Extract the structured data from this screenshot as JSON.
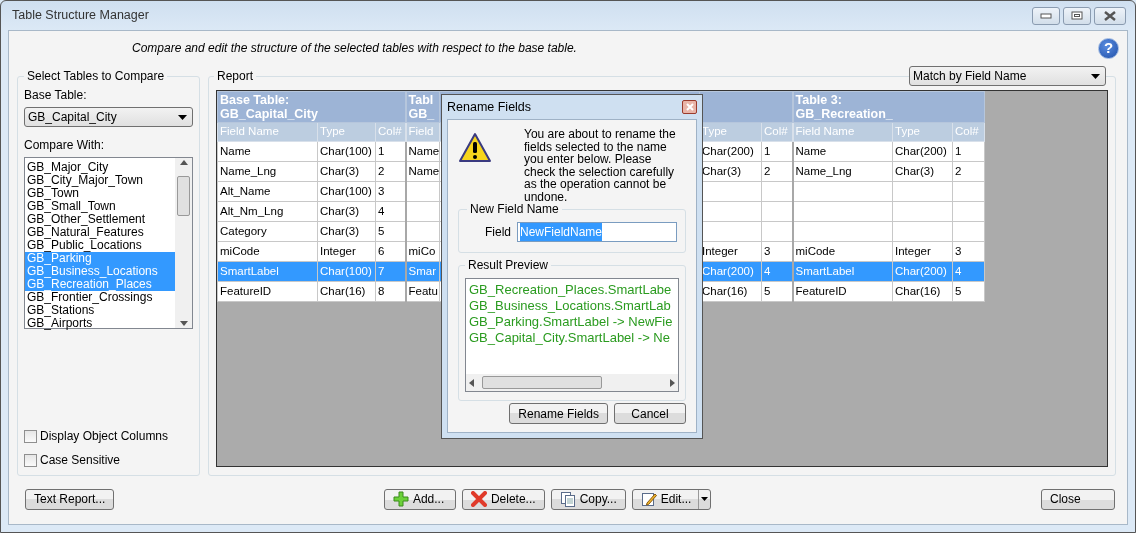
{
  "window": {
    "title": "Table Structure Manager"
  },
  "help_button": "?",
  "description": "Compare and edit the structure of the selected tables with respect to the base table.",
  "select_panel": {
    "title": "Select Tables to Compare",
    "base_label": "Base Table:",
    "base_value": "GB_Capital_City",
    "compare_label": "Compare With:",
    "compare_items": [
      {
        "label": "GB_Major_City",
        "selected": false
      },
      {
        "label": "GB_City_Major_Town",
        "selected": false
      },
      {
        "label": "GB_Town",
        "selected": false
      },
      {
        "label": "GB_Small_Town",
        "selected": false
      },
      {
        "label": "GB_Other_Settlement",
        "selected": false
      },
      {
        "label": "GB_Natural_Features",
        "selected": false
      },
      {
        "label": "GB_Public_Locations",
        "selected": false
      },
      {
        "label": "GB_Parking",
        "selected": true
      },
      {
        "label": "GB_Business_Locations",
        "selected": true
      },
      {
        "label": "GB_Recreation_Places",
        "selected": true
      },
      {
        "label": "GB_Frontier_Crossings",
        "selected": false
      },
      {
        "label": "GB_Stations",
        "selected": false
      },
      {
        "label": "GB_Airports",
        "selected": false
      }
    ],
    "options": [
      {
        "label": "Display Object Columns",
        "checked": false
      },
      {
        "label": "Case Sensitive",
        "checked": false
      }
    ]
  },
  "report": {
    "title": "Report",
    "match_mode": "Match by Field Name",
    "groups": [
      {
        "title": "Base Table:",
        "subtitle": "GB_Capital_City",
        "columns": [
          "Field Name",
          "Type",
          "Col#"
        ]
      },
      {
        "title": "Tabl",
        "subtitle": "GB_",
        "columns": [
          "Field"
        ]
      },
      {
        "columns": [
          "Type",
          "Col#"
        ]
      },
      {
        "title": "Table 3:",
        "subtitle": "GB_Recreation_",
        "columns": [
          "Field Name",
          "Type",
          "Col#"
        ]
      }
    ],
    "rows": [
      {
        "selected": false,
        "cells": [
          "Name",
          "Char(100)",
          "1",
          "Name",
          "Char(200)",
          "1",
          "Name",
          "Char(200)",
          "1"
        ]
      },
      {
        "selected": false,
        "cells": [
          "Name_Lng",
          "Char(3)",
          "2",
          "Name",
          "Char(3)",
          "2",
          "Name_Lng",
          "Char(3)",
          "2"
        ]
      },
      {
        "selected": false,
        "cells": [
          "Alt_Name",
          "Char(100)",
          "3",
          null,
          null,
          null,
          null,
          null,
          null
        ]
      },
      {
        "selected": false,
        "cells": [
          "Alt_Nm_Lng",
          "Char(3)",
          "4",
          null,
          null,
          null,
          null,
          null,
          null
        ]
      },
      {
        "selected": false,
        "cells": [
          "Category",
          "Char(3)",
          "5",
          null,
          null,
          null,
          null,
          null,
          null
        ]
      },
      {
        "selected": false,
        "cells": [
          "miCode",
          "Integer",
          "6",
          "miCo",
          "Integer",
          "3",
          "miCode",
          "Integer",
          "3"
        ]
      },
      {
        "selected": true,
        "cells": [
          "SmartLabel",
          "Char(100)",
          "7",
          "Smar",
          "Char(200)",
          "4",
          "SmartLabel",
          "Char(200)",
          "4"
        ]
      },
      {
        "selected": false,
        "cells": [
          "FeatureID",
          "Char(16)",
          "8",
          "Featu",
          "Char(16)",
          "5",
          "FeatureID",
          "Char(16)",
          "5"
        ]
      }
    ]
  },
  "buttons": [
    {
      "label": "Text Report...",
      "kind": "plain"
    },
    {
      "label": "Add...",
      "kind": "add"
    },
    {
      "label": "Delete...",
      "kind": "delete"
    },
    {
      "label": "Copy...",
      "kind": "copy"
    },
    {
      "label": "Edit...",
      "kind": "edit"
    },
    {
      "label": "Close",
      "kind": "plain"
    }
  ],
  "dialog": {
    "title": "Rename Fields",
    "message": "You are about to rename the fields selected to the name you enter below. Please check the selection carefully as the operation cannot be undone.",
    "group_title": "New Field Name",
    "field_label": "Field",
    "field_value": "NewFieldName",
    "preview_title": "Result Preview",
    "preview_lines": [
      "GB_Recreation_Places.SmartLabe",
      "GB_Business_Locations.SmartLab",
      "GB_Parking.SmartLabel -> NewFie",
      "GB_Capital_City.SmartLabel -> Ne"
    ],
    "buttons": [
      "Rename Fields",
      "Cancel"
    ]
  }
}
